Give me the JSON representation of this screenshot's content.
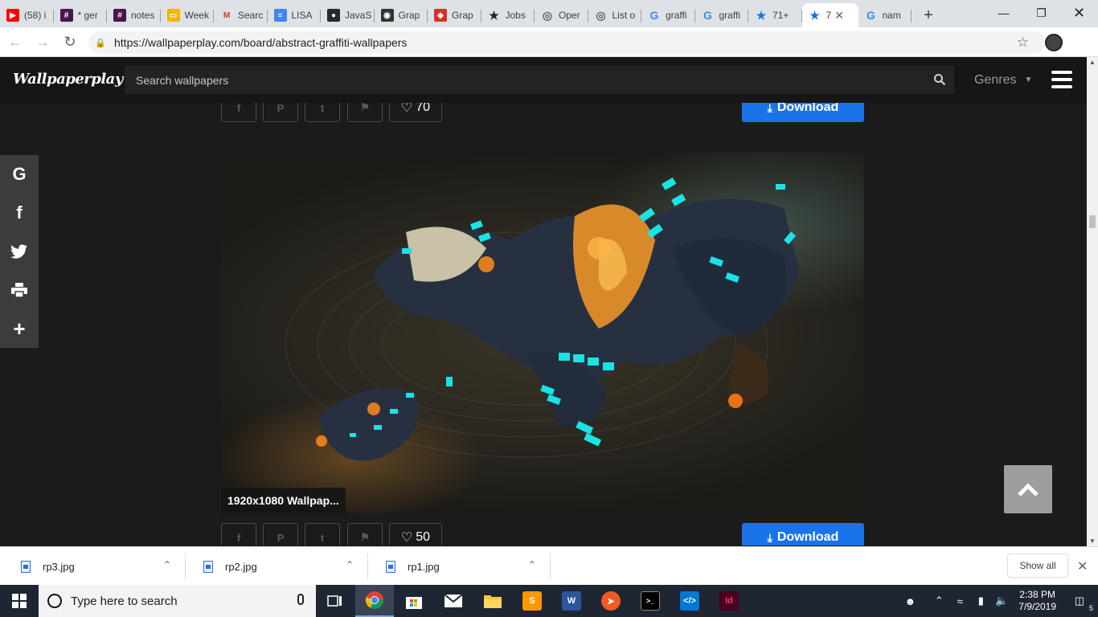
{
  "tabs": [
    {
      "label": "(58) i",
      "icon": "youtube-icon",
      "color": "#ff0000",
      "glyph": "▶"
    },
    {
      "label": "* ger",
      "icon": "slack-icon",
      "color": "#4a154b",
      "glyph": "#"
    },
    {
      "label": "notes",
      "icon": "slack-icon",
      "color": "#4a154b",
      "glyph": "#"
    },
    {
      "label": "Week",
      "icon": "slides-icon",
      "color": "#f4b400",
      "glyph": "▭"
    },
    {
      "label": "Searc",
      "icon": "gmail-icon",
      "color": "#ffffff",
      "glyph": "M"
    },
    {
      "label": "LISA",
      "icon": "docs-icon",
      "color": "#4285f4",
      "glyph": "≡"
    },
    {
      "label": "JavaS",
      "icon": "github-icon",
      "color": "#24292e",
      "glyph": "●"
    },
    {
      "label": "Grap",
      "icon": "graph-icon",
      "color": "#333333",
      "glyph": "◉"
    },
    {
      "label": "Grap",
      "icon": "graph-red-icon",
      "color": "#d93025",
      "glyph": "◆"
    },
    {
      "label": "Jobs",
      "icon": "star-black-icon",
      "color": "#222222",
      "glyph": "★"
    },
    {
      "label": "Oper",
      "icon": "globe-icon",
      "color": "#5f6368",
      "glyph": "◎"
    },
    {
      "label": "List o",
      "icon": "globe-icon",
      "color": "#5f6368",
      "glyph": "◎"
    },
    {
      "label": "graffi",
      "icon": "google-icon",
      "color": "#4285f4",
      "glyph": "G"
    },
    {
      "label": "graffi",
      "icon": "google-icon",
      "color": "#4285f4",
      "glyph": "G"
    },
    {
      "label": "71+",
      "icon": "star-blue-icon",
      "color": "#1a73e8",
      "glyph": "★"
    },
    {
      "label": "7",
      "icon": "star-blue-icon",
      "color": "#1a73e8",
      "glyph": "★",
      "active": true
    },
    {
      "label": "nam",
      "icon": "google-icon",
      "color": "#4285f4",
      "glyph": "G"
    }
  ],
  "browser": {
    "url": "https://wallpaperplay.com/board/abstract-graffiti-wallpapers"
  },
  "site": {
    "logo": "Wallpaperplay",
    "search_placeholder": "Search wallpapers",
    "genres_label": "Genres"
  },
  "rows": [
    {
      "likes": "70",
      "download_label": "Download"
    },
    {
      "likes": "50",
      "download_label": "Download"
    }
  ],
  "wallpaper": {
    "resolution_label": "1920x1080 Wallpap..."
  },
  "downloads": [
    {
      "name": "rp3.jpg"
    },
    {
      "name": "rp2.jpg"
    },
    {
      "name": "rp1.jpg"
    }
  ],
  "shelf": {
    "show_all": "Show all"
  },
  "taskbar": {
    "search_placeholder": "Type here to search",
    "time": "2:38 PM",
    "date": "7/9/2019",
    "notification_count": "5"
  },
  "colors": {
    "accent_download": "#1a73e8",
    "site_bg": "#1b1b1b"
  }
}
